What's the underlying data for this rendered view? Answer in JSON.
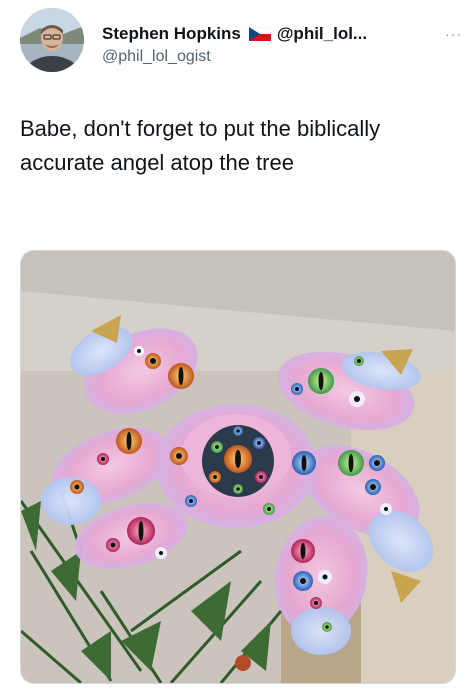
{
  "tweet": {
    "author": {
      "display_name": "Stephen Hopkins",
      "handle_truncated": "@phil_lol...",
      "handle": "@phil_lol_ogist",
      "flag": "czech-flag-emoji"
    },
    "more_icon": "···",
    "text": "Babe, don't forget to put the biblically accurate angel atop the tree"
  },
  "colors": {
    "text": "#0f1419",
    "secondary": "#536471",
    "feather_pink": "#f2b6d8",
    "feather_blue": "#b8c8f0",
    "eye_orange": "#e07a2a",
    "eye_green": "#7bc46a"
  }
}
